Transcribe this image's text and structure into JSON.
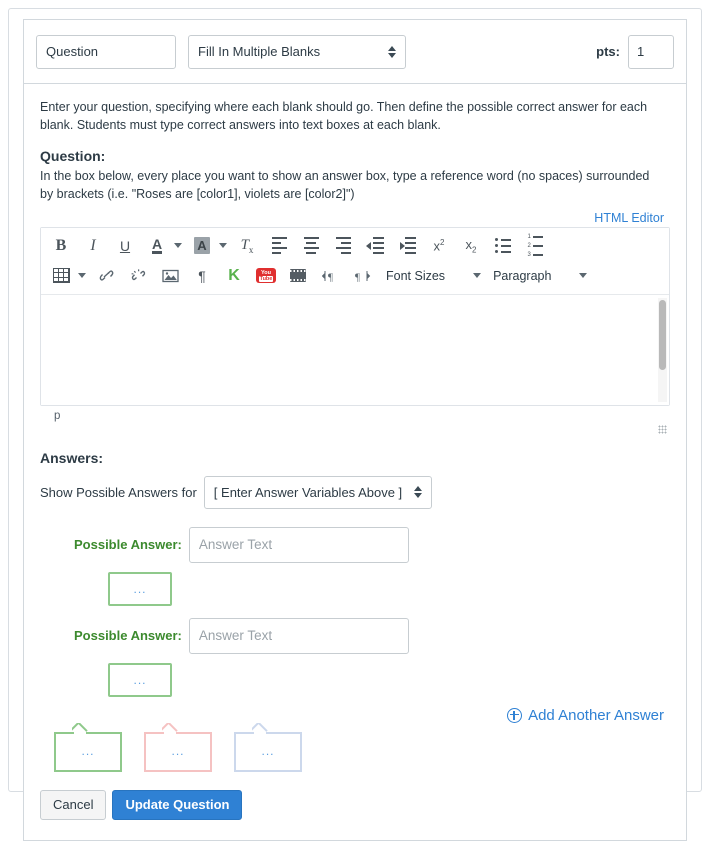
{
  "header": {
    "question_name": "Question",
    "question_name_placeholder": "Question",
    "question_type": "Fill In Multiple Blanks",
    "pts_label": "pts:",
    "pts_value": "1"
  },
  "instructions": {
    "intro": "Enter your question, specifying where each blank should go. Then define the possible correct answer for each blank. Students must type correct answers into text boxes at each blank.",
    "question_heading": "Question:",
    "question_hint": "In the box below, every place you want to show an answer box, type a reference word (no spaces) surrounded by brackets (i.e. \"Roses are [color1], violets are [color2]\")",
    "html_editor_link": "HTML Editor"
  },
  "editor": {
    "content": "",
    "status_path": "p",
    "toolbar_row1": [
      {
        "name": "bold-icon",
        "label": "B"
      },
      {
        "name": "italic-icon",
        "label": "I"
      },
      {
        "name": "underline-icon",
        "label": "U"
      },
      {
        "name": "text-color-icon",
        "label": "A"
      },
      {
        "name": "background-color-icon",
        "label": "A"
      },
      {
        "name": "remove-formatting-icon",
        "label": "Tx"
      },
      {
        "name": "align-left-icon",
        "label": ""
      },
      {
        "name": "align-center-icon",
        "label": ""
      },
      {
        "name": "align-right-icon",
        "label": ""
      },
      {
        "name": "outdent-icon",
        "label": ""
      },
      {
        "name": "indent-icon",
        "label": ""
      },
      {
        "name": "superscript-icon",
        "label": "x2"
      },
      {
        "name": "subscript-icon",
        "label": "x2"
      },
      {
        "name": "bullet-list-icon",
        "label": ""
      },
      {
        "name": "numbered-list-icon",
        "label": ""
      }
    ],
    "toolbar_row2": [
      {
        "name": "table-icon",
        "label": ""
      },
      {
        "name": "link-icon",
        "label": ""
      },
      {
        "name": "unlink-icon",
        "label": ""
      },
      {
        "name": "image-icon",
        "label": ""
      },
      {
        "name": "pilcrow-icon",
        "label": "¶"
      },
      {
        "name": "kaltura-icon",
        "label": "K"
      },
      {
        "name": "youtube-icon",
        "label": "You Tube"
      },
      {
        "name": "media-icon",
        "label": ""
      },
      {
        "name": "ltr-icon",
        "label": ""
      },
      {
        "name": "rtl-icon",
        "label": ""
      }
    ],
    "font_sizes_label": "Font Sizes",
    "paragraph_label": "Paragraph"
  },
  "answers": {
    "heading": "Answers:",
    "show_answers_label": "Show Possible Answers for",
    "variable_select_value": "[ Enter Answer Variables Above ]",
    "items": [
      {
        "label": "Possible Answer:",
        "value": "",
        "placeholder": "Answer Text",
        "comment_text": "..."
      },
      {
        "label": "Possible Answer:",
        "value": "",
        "placeholder": "Answer Text",
        "comment_text": "..."
      }
    ],
    "add_answer_label": "Add Another Answer"
  },
  "comment_bubbles": [
    {
      "name": "correct-comment-bubble",
      "text": "...",
      "variant": "green"
    },
    {
      "name": "incorrect-comment-bubble",
      "text": "...",
      "variant": "pink"
    },
    {
      "name": "general-comment-bubble",
      "text": "...",
      "variant": "blue"
    }
  ],
  "footer": {
    "cancel_label": "Cancel",
    "update_label": "Update Question"
  },
  "colors": {
    "primary_blue": "#2f81d4",
    "link_blue": "#2f81d4",
    "green_label": "#3c8a2e",
    "green_border": "#8fc98b",
    "pink_border": "#f5c2c2",
    "blue_border": "#ccd8ec"
  }
}
